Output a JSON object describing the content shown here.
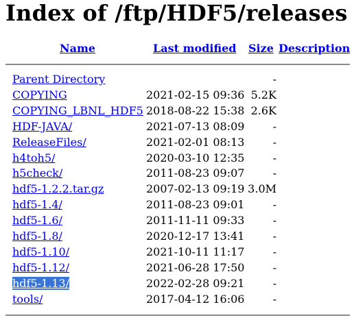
{
  "page": {
    "title": "Index of /ftp/HDF5/releases"
  },
  "table": {
    "columns": {
      "name": "Name",
      "last_modified": "Last modified",
      "size": "Size",
      "description": "Description"
    },
    "rows": [
      {
        "name": "Parent Directory",
        "date": "",
        "size": "-"
      },
      {
        "name": "COPYING",
        "date": "2021-02-15 09:36",
        "size": "5.2K"
      },
      {
        "name": "COPYING_LBNL_HDF5",
        "date": "2018-08-22 15:38",
        "size": "2.6K"
      },
      {
        "name": "HDF-JAVA/",
        "date": "2021-07-13 08:09",
        "size": "-"
      },
      {
        "name": "ReleaseFiles/",
        "date": "2021-02-01 08:13",
        "size": "-"
      },
      {
        "name": "h4toh5/",
        "date": "2020-03-10 12:35",
        "size": "-"
      },
      {
        "name": "h5check/",
        "date": "2011-08-23 09:07",
        "size": "-"
      },
      {
        "name": "hdf5-1.2.2.tar.gz",
        "date": "2007-02-13 09:19",
        "size": "3.0M"
      },
      {
        "name": "hdf5-1.4/",
        "date": "2011-08-23 09:01",
        "size": "-"
      },
      {
        "name": "hdf5-1.6/",
        "date": "2011-11-11 09:33",
        "size": "-"
      },
      {
        "name": "hdf5-1.8/",
        "date": "2020-12-17 13:41",
        "size": "-"
      },
      {
        "name": "hdf5-1.10/",
        "date": "2021-10-11 11:17",
        "size": "-"
      },
      {
        "name": "hdf5-1.12/",
        "date": "2021-06-28 17:50",
        "size": "-"
      },
      {
        "name": "hdf5-1.13/",
        "date": "2022-02-28 09:21",
        "size": "-"
      },
      {
        "name": "tools/",
        "date": "2017-04-12 16:06",
        "size": "-"
      }
    ]
  },
  "colors": {
    "link": "#0000ee",
    "selection": "#3875d7"
  }
}
